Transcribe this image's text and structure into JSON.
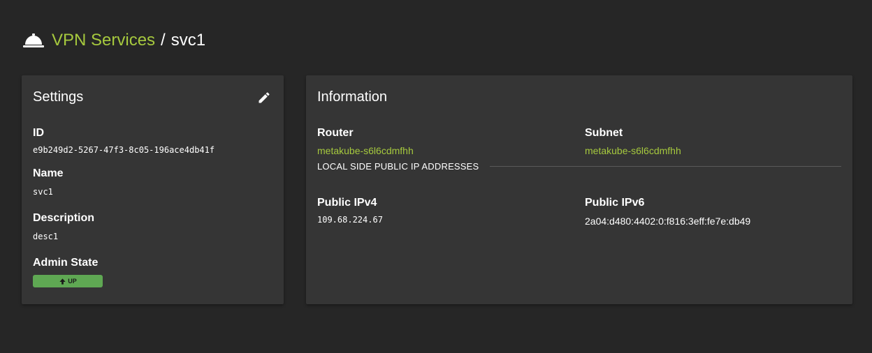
{
  "breadcrumb": {
    "icon": "concierge-bell-icon",
    "parent": "VPN Services",
    "separator": "/",
    "current": "svc1"
  },
  "accent_color": "#a6c93e",
  "settings": {
    "title": "Settings",
    "edit_icon": "pencil-icon",
    "id_label": "ID",
    "id_value": "e9b249d2-5267-47f3-8c05-196ace4db41f",
    "name_label": "Name",
    "name_value": "svc1",
    "description_label": "Description",
    "description_value": "desc1",
    "admin_state_label": "Admin State",
    "admin_state_value": "UP",
    "admin_state_color": "#5fa853"
  },
  "information": {
    "title": "Information",
    "router_label": "Router",
    "router_value": "metakube-s6l6cdmfhh",
    "subnet_label": "Subnet",
    "subnet_value": "metakube-s6l6cdmfhh",
    "section_title": "LOCAL SIDE PUBLIC IP ADDRESSES",
    "ipv4_label": "Public IPv4",
    "ipv4_value": "109.68.224.67",
    "ipv6_label": "Public IPv6",
    "ipv6_value": "2a04:d480:4402:0:f816:3eff:fe7e:db49"
  }
}
